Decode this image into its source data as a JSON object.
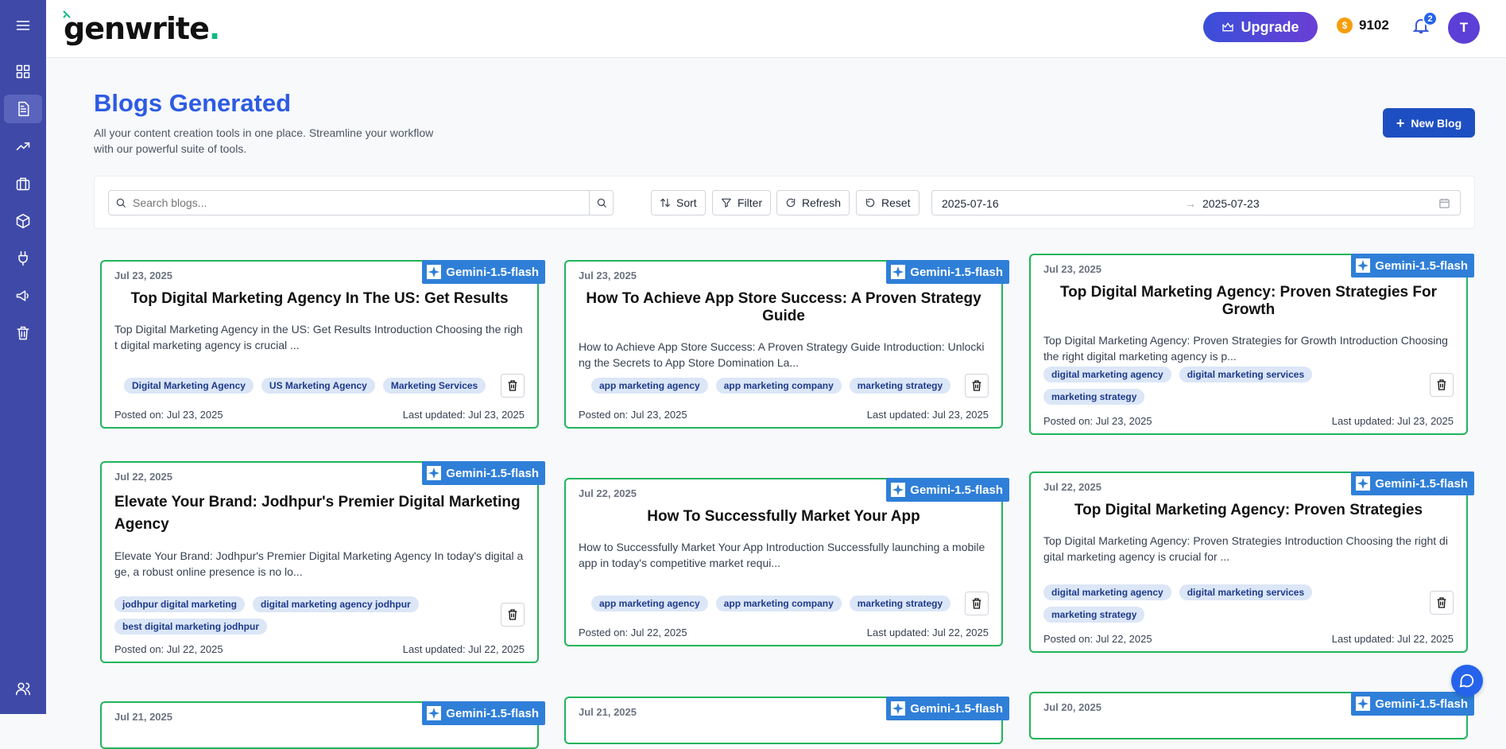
{
  "brand": {
    "name": "genwrite",
    "dot": "."
  },
  "header": {
    "upgrade_label": "Upgrade",
    "credits": "9102",
    "notifications": "2",
    "avatar_initial": "T"
  },
  "page": {
    "title": "Blogs Generated",
    "subtitle": "All your content creation tools in one place. Streamline your workflow with our powerful suite of tools.",
    "new_blog_label": "New Blog"
  },
  "toolbar": {
    "search_placeholder": "Search blogs...",
    "sort_label": "Sort",
    "filter_label": "Filter",
    "refresh_label": "Refresh",
    "reset_label": "Reset",
    "date_start": "2025-07-16",
    "date_arrow": "→",
    "date_end": "2025-07-23"
  },
  "sidebar_icons": [
    "menu-icon",
    "dashboard-icon",
    "blog-icon",
    "trending-icon",
    "briefcase-icon",
    "cube-icon",
    "plug-icon",
    "megaphone-icon",
    "trash-icon",
    "user-icon"
  ],
  "cards": [
    {
      "date": "Jul 23, 2025",
      "model": "Gemini-1.5-flash",
      "title": "Top Digital Marketing Agency In The US: Get Results",
      "excerpt": "Top Digital Marketing Agency in the US: Get Results Introduction Choosing the right digital marketing agency is crucial ...",
      "tags": [
        "Digital Marketing Agency",
        "US Marketing Agency",
        "Marketing Services"
      ],
      "posted": "Posted on: Jul 23, 2025",
      "updated": "Last updated: Jul 23, 2025"
    },
    {
      "date": "Jul 23, 2025",
      "model": "Gemini-1.5-flash",
      "title": "How To Achieve App Store Success: A Proven Strategy Guide",
      "excerpt": "How to Achieve App Store Success: A Proven Strategy Guide Introduction: Unlocking the Secrets to App Store Domination La...",
      "tags": [
        "app marketing agency",
        "app marketing company",
        "marketing strategy"
      ],
      "posted": "Posted on: Jul 23, 2025",
      "updated": "Last updated: Jul 23, 2025"
    },
    {
      "date": "Jul 23, 2025",
      "model": "Gemini-1.5-flash",
      "title": "Top Digital Marketing Agency: Proven Strategies For Growth",
      "excerpt": "Top Digital Marketing Agency: Proven Strategies for Growth Introduction Choosing the right digital marketing agency is p...",
      "tags": [
        "digital marketing agency",
        "digital marketing services",
        "marketing strategy"
      ],
      "posted": "Posted on: Jul 23, 2025",
      "updated": "Last updated: Jul 23, 2025"
    },
    {
      "date": "Jul 22, 2025",
      "model": "Gemini-1.5-flash",
      "title": "Elevate Your Brand: Jodhpur's Premier Digital Marketing Agency",
      "excerpt": "Elevate Your Brand: Jodhpur's Premier Digital Marketing Agency In today's digital age, a robust online presence is no lo...",
      "tags": [
        "jodhpur digital marketing",
        "digital marketing agency jodhpur",
        "best digital marketing jodhpur"
      ],
      "posted": "Posted on: Jul 22, 2025",
      "updated": "Last updated: Jul 22, 2025"
    },
    {
      "date": "Jul 22, 2025",
      "model": "Gemini-1.5-flash",
      "title": "How To Successfully Market Your App",
      "excerpt": "How to Successfully Market Your App Introduction Successfully launching a mobile app in today's competitive market requi...",
      "tags": [
        "app marketing agency",
        "app marketing company",
        "marketing strategy"
      ],
      "posted": "Posted on: Jul 22, 2025",
      "updated": "Last updated: Jul 22, 2025"
    },
    {
      "date": "Jul 22, 2025",
      "model": "Gemini-1.5-flash",
      "title": "Top Digital Marketing Agency: Proven Strategies",
      "excerpt": "Top Digital Marketing Agency: Proven Strategies Introduction Choosing the right digital marketing agency is crucial for ...",
      "tags": [
        "digital marketing agency",
        "digital marketing services",
        "marketing strategy"
      ],
      "posted": "Posted on: Jul 22, 2025",
      "updated": "Last updated: Jul 22, 2025"
    },
    {
      "date": "Jul 21, 2025",
      "model": "Gemini-1.5-flash"
    },
    {
      "date": "Jul 21, 2025",
      "model": "Gemini-1.5-flash"
    },
    {
      "date": "Jul 20, 2025",
      "model": "Gemini-1.5-flash"
    }
  ]
}
